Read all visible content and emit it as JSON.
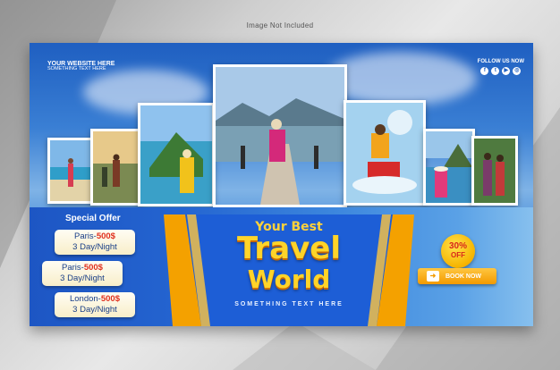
{
  "watermark": "Image Not Included",
  "website": {
    "line1": "YOUR WEBSITE HERE",
    "line2": "SOMETHING TEXT HERE"
  },
  "social": {
    "label": "FOLLOW US NOW",
    "icons": [
      "facebook-icon",
      "twitter-icon",
      "youtube-icon",
      "instagram-icon"
    ]
  },
  "special_offer": {
    "title": "Special Offer",
    "items": [
      {
        "city": "Paris-",
        "price": "500$",
        "duration": "3 Day/Night"
      },
      {
        "city": "Paris-",
        "price": "500$",
        "duration": "3 Day/Night"
      },
      {
        "city": "London-",
        "price": "500$",
        "duration": "3 Day/Night"
      }
    ]
  },
  "headline": {
    "top": "Your Best",
    "line1": "Travel",
    "line2": "World",
    "tagline": "SOMETHING TEXT HERE"
  },
  "discount": {
    "percent": "30%",
    "label": "OFF"
  },
  "cta": {
    "label": "BOOK NOW"
  },
  "colors": {
    "brand_blue": "#1f5fc1",
    "accent_orange": "#f39a00",
    "headline_yellow": "#ffd429"
  }
}
